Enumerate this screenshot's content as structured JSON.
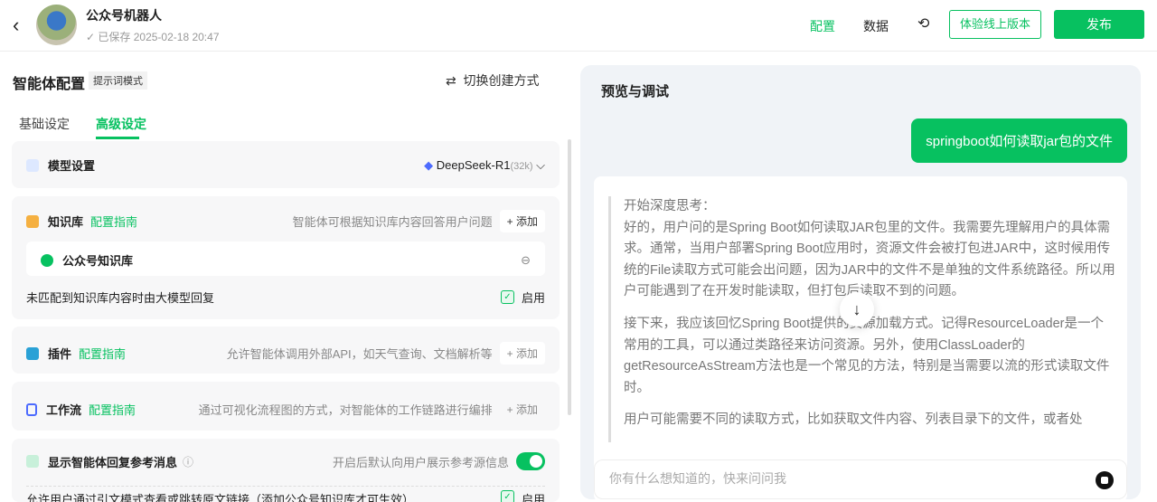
{
  "header": {
    "title": "公众号机器人",
    "saved": "已保存 2025-02-18 20:47",
    "nav_config": "配置",
    "nav_data": "数据",
    "trial_button": "体验线上版本",
    "publish_button": "发布"
  },
  "left": {
    "title": "智能体配置",
    "mode_tag": "提示词模式",
    "switch_label": "切换创建方式",
    "tabs": [
      "基础设定",
      "高级设定"
    ],
    "model": {
      "label": "模型设置",
      "name": "DeepSeek-R1",
      "ctx": "(32k)"
    },
    "knowledge": {
      "label": "知识库",
      "guide": "配置指南",
      "desc": "智能体可根据知识库内容回答用户问题",
      "add": "+ 添加",
      "item": "公众号知识库",
      "fallback": "未匹配到知识库内容时由大模型回复",
      "enable": "启用"
    },
    "plugin": {
      "label": "插件",
      "guide": "配置指南",
      "desc": "允许智能体调用外部API，如天气查询、文档解析等",
      "add": "+ 添加"
    },
    "workflow": {
      "label": "工作流",
      "guide": "配置指南",
      "desc": "通过可视化流程图的方式，对智能体的工作链路进行编排",
      "add": "+ 添加"
    },
    "reference": {
      "label": "显示智能体回复参考消息",
      "desc": "开启后默认向用户展示参考源信息",
      "sub": "允许用户通过引文模式查看或跳转原文链接（添加公众号知识库才可生效）",
      "enable": "启用"
    }
  },
  "right": {
    "title": "预览与调试",
    "user_message": "springboot如何读取jar包的文件",
    "thinking": [
      "开始深度思考：\n好的，用户问的是Spring Boot如何读取JAR包里的文件。我需要先理解用户的具体需求。通常，当用户部署Spring Boot应用时，资源文件会被打包进JAR中，这时候用传统的File读取方式可能会出问题，因为JAR中的文件不是单独的文件系统路径。所以用户可能遇到了在开发时能读取，但打包后读取不到的问题。",
      "接下来，我应该回忆Spring Boot提供的资源加载方式。记得ResourceLoader是一个常用的工具，可以通过类路径来访问资源。另外，使用ClassLoader的getResourceAsStream方法也是一个常见的方法，特别是当需要以流的形式读取文件时。",
      "用户可能需要不同的读取方式，比如获取文件内容、列表目录下的文件，或者处"
    ],
    "input_placeholder": "你有什么想知道的，快来问问我"
  }
}
